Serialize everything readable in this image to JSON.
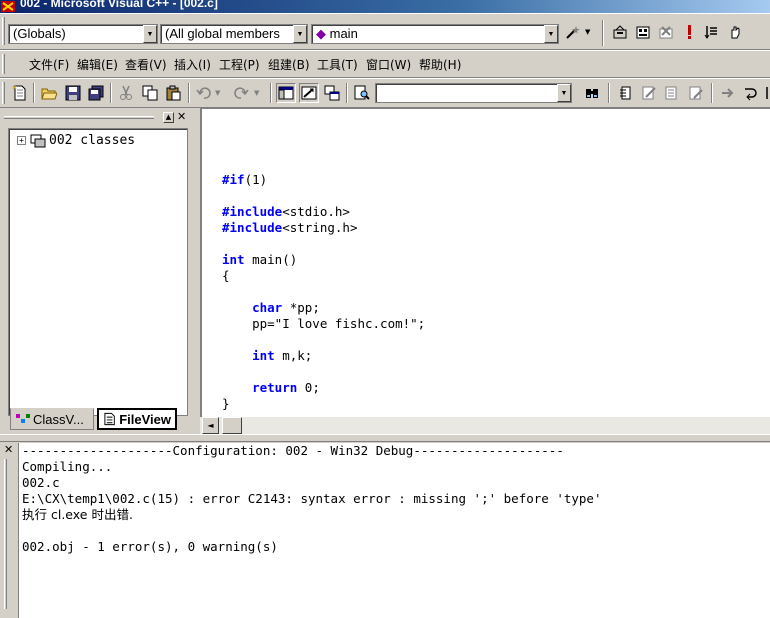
{
  "window": {
    "title": "002 - Microsoft Visual C++ - [002.c]"
  },
  "wizardbar": {
    "scope": "(Globals)",
    "members": "(All global members",
    "function": "main"
  },
  "menu": [
    "文件(F)",
    "编辑(E)",
    "查看(V)",
    "插入(I)",
    "工程(P)",
    "组建(B)",
    "工具(T)",
    "窗口(W)",
    "帮助(H)"
  ],
  "toolbar": {
    "find_value": ""
  },
  "workspace": {
    "tree_root": "002 classes",
    "tabs": [
      "ClassV...",
      "FileView"
    ]
  },
  "editor": {
    "lines": [
      "",
      "#if(1)",
      "",
      "#include<stdio.h>",
      "#include<string.h>",
      "",
      "int main()",
      "{",
      "",
      "    char *pp;",
      "    pp=\"I love fishc.com!\";",
      "",
      "    int m,k;",
      "",
      "    return 0;",
      "}"
    ]
  },
  "output": {
    "lines": [
      "--------------------Configuration: 002 - Win32 Debug--------------------",
      "Compiling...",
      "002.c",
      "E:\\CX\\temp1\\002.c(15) : error C2143: syntax error : missing ';' before 'type'",
      "执行 cl.exe 时出错.",
      "",
      "002.obj - 1 error(s), 0 warning(s)"
    ]
  },
  "colors": {
    "keyword": "#0000ff",
    "title_bar": "#0a246a"
  }
}
